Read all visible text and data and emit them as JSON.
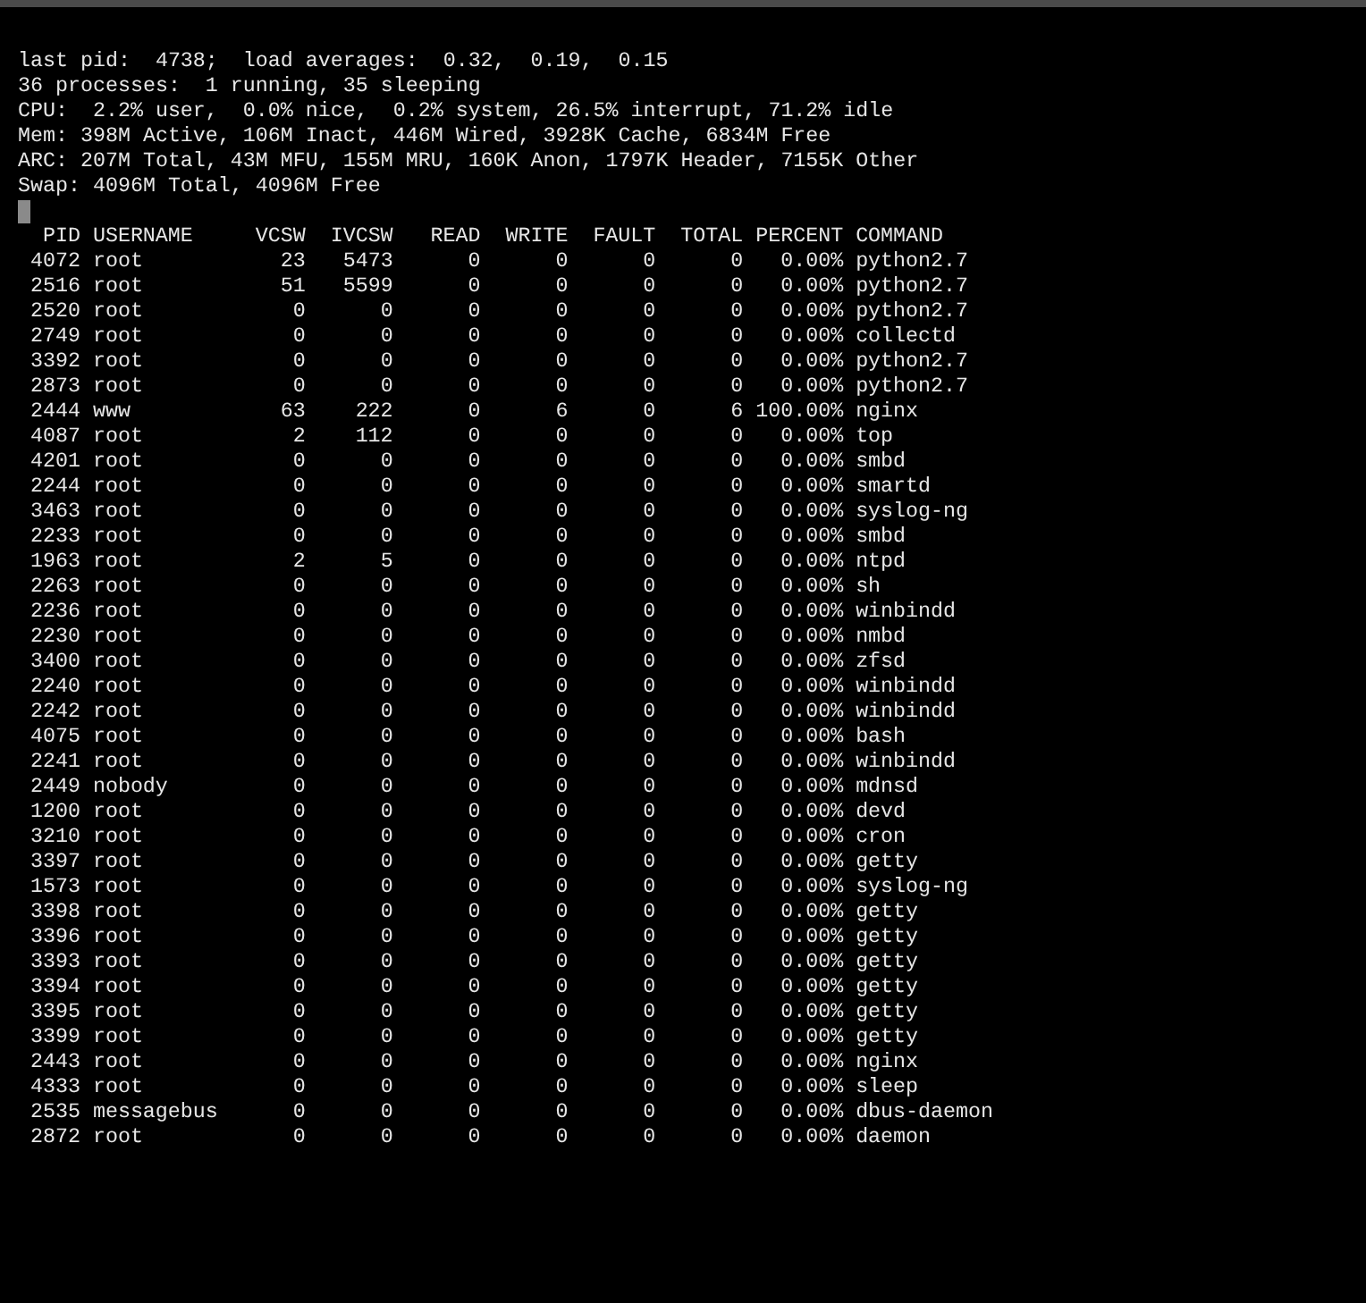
{
  "terminal": {
    "summary_lines": [
      "last pid:  4738;  load averages:  0.32,  0.19,  0.15",
      "36 processes:  1 running, 35 sleeping",
      "CPU:  2.2% user,  0.0% nice,  0.2% system, 26.5% interrupt, 71.2% idle",
      "Mem: 398M Active, 106M Inact, 446M Wired, 3928K Cache, 6834M Free",
      "ARC: 207M Total, 43M MFU, 155M MRU, 160K Anon, 1797K Header, 7155K Other",
      "Swap: 4096M Total, 4096M Free"
    ],
    "cursor": {
      "visible": true
    },
    "table": {
      "columns": [
        "PID",
        "USERNAME",
        "VCSW",
        "IVCSW",
        "READ",
        "WRITE",
        "FAULT",
        "TOTAL",
        "PERCENT",
        "COMMAND"
      ],
      "rows": [
        {
          "pid": "4072",
          "username": "root",
          "vcsw": "23",
          "ivcsw": "5473",
          "read": "0",
          "write": "0",
          "fault": "0",
          "total": "0",
          "percent": "0.00%",
          "command": "python2.7"
        },
        {
          "pid": "2516",
          "username": "root",
          "vcsw": "51",
          "ivcsw": "5599",
          "read": "0",
          "write": "0",
          "fault": "0",
          "total": "0",
          "percent": "0.00%",
          "command": "python2.7"
        },
        {
          "pid": "2520",
          "username": "root",
          "vcsw": "0",
          "ivcsw": "0",
          "read": "0",
          "write": "0",
          "fault": "0",
          "total": "0",
          "percent": "0.00%",
          "command": "python2.7"
        },
        {
          "pid": "2749",
          "username": "root",
          "vcsw": "0",
          "ivcsw": "0",
          "read": "0",
          "write": "0",
          "fault": "0",
          "total": "0",
          "percent": "0.00%",
          "command": "collectd"
        },
        {
          "pid": "3392",
          "username": "root",
          "vcsw": "0",
          "ivcsw": "0",
          "read": "0",
          "write": "0",
          "fault": "0",
          "total": "0",
          "percent": "0.00%",
          "command": "python2.7"
        },
        {
          "pid": "2873",
          "username": "root",
          "vcsw": "0",
          "ivcsw": "0",
          "read": "0",
          "write": "0",
          "fault": "0",
          "total": "0",
          "percent": "0.00%",
          "command": "python2.7"
        },
        {
          "pid": "2444",
          "username": "www",
          "vcsw": "63",
          "ivcsw": "222",
          "read": "0",
          "write": "6",
          "fault": "0",
          "total": "6",
          "percent": "100.00%",
          "command": "nginx"
        },
        {
          "pid": "4087",
          "username": "root",
          "vcsw": "2",
          "ivcsw": "112",
          "read": "0",
          "write": "0",
          "fault": "0",
          "total": "0",
          "percent": "0.00%",
          "command": "top"
        },
        {
          "pid": "4201",
          "username": "root",
          "vcsw": "0",
          "ivcsw": "0",
          "read": "0",
          "write": "0",
          "fault": "0",
          "total": "0",
          "percent": "0.00%",
          "command": "smbd"
        },
        {
          "pid": "2244",
          "username": "root",
          "vcsw": "0",
          "ivcsw": "0",
          "read": "0",
          "write": "0",
          "fault": "0",
          "total": "0",
          "percent": "0.00%",
          "command": "smartd"
        },
        {
          "pid": "3463",
          "username": "root",
          "vcsw": "0",
          "ivcsw": "0",
          "read": "0",
          "write": "0",
          "fault": "0",
          "total": "0",
          "percent": "0.00%",
          "command": "syslog-ng"
        },
        {
          "pid": "2233",
          "username": "root",
          "vcsw": "0",
          "ivcsw": "0",
          "read": "0",
          "write": "0",
          "fault": "0",
          "total": "0",
          "percent": "0.00%",
          "command": "smbd"
        },
        {
          "pid": "1963",
          "username": "root",
          "vcsw": "2",
          "ivcsw": "5",
          "read": "0",
          "write": "0",
          "fault": "0",
          "total": "0",
          "percent": "0.00%",
          "command": "ntpd"
        },
        {
          "pid": "2263",
          "username": "root",
          "vcsw": "0",
          "ivcsw": "0",
          "read": "0",
          "write": "0",
          "fault": "0",
          "total": "0",
          "percent": "0.00%",
          "command": "sh"
        },
        {
          "pid": "2236",
          "username": "root",
          "vcsw": "0",
          "ivcsw": "0",
          "read": "0",
          "write": "0",
          "fault": "0",
          "total": "0",
          "percent": "0.00%",
          "command": "winbindd"
        },
        {
          "pid": "2230",
          "username": "root",
          "vcsw": "0",
          "ivcsw": "0",
          "read": "0",
          "write": "0",
          "fault": "0",
          "total": "0",
          "percent": "0.00%",
          "command": "nmbd"
        },
        {
          "pid": "3400",
          "username": "root",
          "vcsw": "0",
          "ivcsw": "0",
          "read": "0",
          "write": "0",
          "fault": "0",
          "total": "0",
          "percent": "0.00%",
          "command": "zfsd"
        },
        {
          "pid": "2240",
          "username": "root",
          "vcsw": "0",
          "ivcsw": "0",
          "read": "0",
          "write": "0",
          "fault": "0",
          "total": "0",
          "percent": "0.00%",
          "command": "winbindd"
        },
        {
          "pid": "2242",
          "username": "root",
          "vcsw": "0",
          "ivcsw": "0",
          "read": "0",
          "write": "0",
          "fault": "0",
          "total": "0",
          "percent": "0.00%",
          "command": "winbindd"
        },
        {
          "pid": "4075",
          "username": "root",
          "vcsw": "0",
          "ivcsw": "0",
          "read": "0",
          "write": "0",
          "fault": "0",
          "total": "0",
          "percent": "0.00%",
          "command": "bash"
        },
        {
          "pid": "2241",
          "username": "root",
          "vcsw": "0",
          "ivcsw": "0",
          "read": "0",
          "write": "0",
          "fault": "0",
          "total": "0",
          "percent": "0.00%",
          "command": "winbindd"
        },
        {
          "pid": "2449",
          "username": "nobody",
          "vcsw": "0",
          "ivcsw": "0",
          "read": "0",
          "write": "0",
          "fault": "0",
          "total": "0",
          "percent": "0.00%",
          "command": "mdnsd"
        },
        {
          "pid": "1200",
          "username": "root",
          "vcsw": "0",
          "ivcsw": "0",
          "read": "0",
          "write": "0",
          "fault": "0",
          "total": "0",
          "percent": "0.00%",
          "command": "devd"
        },
        {
          "pid": "3210",
          "username": "root",
          "vcsw": "0",
          "ivcsw": "0",
          "read": "0",
          "write": "0",
          "fault": "0",
          "total": "0",
          "percent": "0.00%",
          "command": "cron"
        },
        {
          "pid": "3397",
          "username": "root",
          "vcsw": "0",
          "ivcsw": "0",
          "read": "0",
          "write": "0",
          "fault": "0",
          "total": "0",
          "percent": "0.00%",
          "command": "getty"
        },
        {
          "pid": "1573",
          "username": "root",
          "vcsw": "0",
          "ivcsw": "0",
          "read": "0",
          "write": "0",
          "fault": "0",
          "total": "0",
          "percent": "0.00%",
          "command": "syslog-ng"
        },
        {
          "pid": "3398",
          "username": "root",
          "vcsw": "0",
          "ivcsw": "0",
          "read": "0",
          "write": "0",
          "fault": "0",
          "total": "0",
          "percent": "0.00%",
          "command": "getty"
        },
        {
          "pid": "3396",
          "username": "root",
          "vcsw": "0",
          "ivcsw": "0",
          "read": "0",
          "write": "0",
          "fault": "0",
          "total": "0",
          "percent": "0.00%",
          "command": "getty"
        },
        {
          "pid": "3393",
          "username": "root",
          "vcsw": "0",
          "ivcsw": "0",
          "read": "0",
          "write": "0",
          "fault": "0",
          "total": "0",
          "percent": "0.00%",
          "command": "getty"
        },
        {
          "pid": "3394",
          "username": "root",
          "vcsw": "0",
          "ivcsw": "0",
          "read": "0",
          "write": "0",
          "fault": "0",
          "total": "0",
          "percent": "0.00%",
          "command": "getty"
        },
        {
          "pid": "3395",
          "username": "root",
          "vcsw": "0",
          "ivcsw": "0",
          "read": "0",
          "write": "0",
          "fault": "0",
          "total": "0",
          "percent": "0.00%",
          "command": "getty"
        },
        {
          "pid": "3399",
          "username": "root",
          "vcsw": "0",
          "ivcsw": "0",
          "read": "0",
          "write": "0",
          "fault": "0",
          "total": "0",
          "percent": "0.00%",
          "command": "getty"
        },
        {
          "pid": "2443",
          "username": "root",
          "vcsw": "0",
          "ivcsw": "0",
          "read": "0",
          "write": "0",
          "fault": "0",
          "total": "0",
          "percent": "0.00%",
          "command": "nginx"
        },
        {
          "pid": "4333",
          "username": "root",
          "vcsw": "0",
          "ivcsw": "0",
          "read": "0",
          "write": "0",
          "fault": "0",
          "total": "0",
          "percent": "0.00%",
          "command": "sleep"
        },
        {
          "pid": "2535",
          "username": "messagebus",
          "vcsw": "0",
          "ivcsw": "0",
          "read": "0",
          "write": "0",
          "fault": "0",
          "total": "0",
          "percent": "0.00%",
          "command": "dbus-daemon"
        },
        {
          "pid": "2872",
          "username": "root",
          "vcsw": "0",
          "ivcsw": "0",
          "read": "0",
          "write": "0",
          "fault": "0",
          "total": "0",
          "percent": "0.00%",
          "command": "daemon"
        }
      ]
    }
  }
}
